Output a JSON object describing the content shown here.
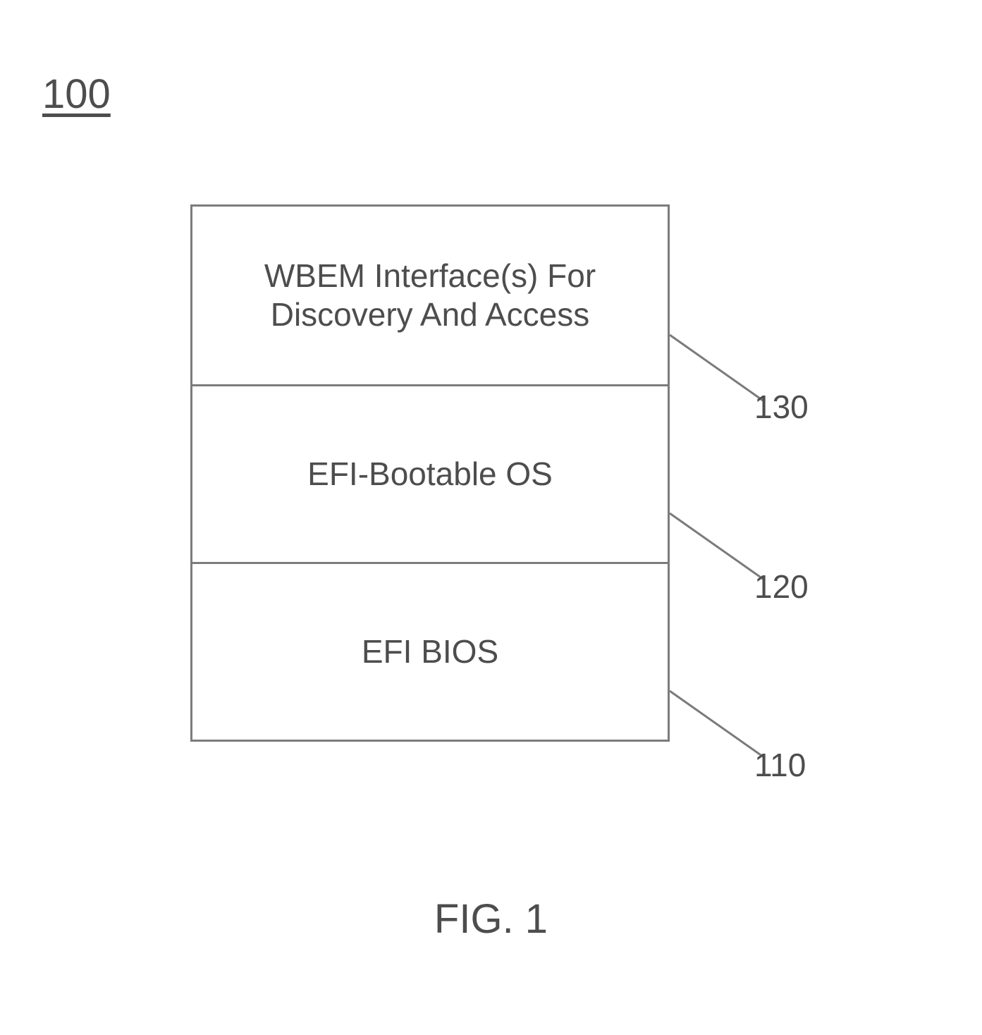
{
  "figure_number": "100",
  "caption": "FIG. 1",
  "layers": [
    {
      "label": "WBEM Interface(s) For\nDiscovery And Access",
      "ref": "130"
    },
    {
      "label": "EFI-Bootable OS",
      "ref": "120"
    },
    {
      "label": "EFI BIOS",
      "ref": "110"
    }
  ]
}
